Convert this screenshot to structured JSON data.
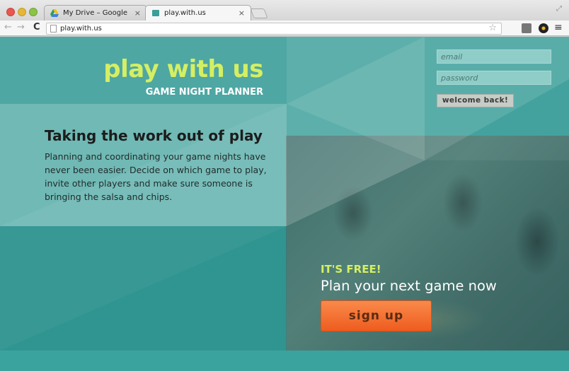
{
  "browser": {
    "tabs": [
      {
        "label": "My Drive – Google Drive",
        "icon": "google-drive-icon",
        "active": false
      },
      {
        "label": "play.with.us",
        "icon": "page-favicon",
        "active": true
      }
    ],
    "tab_close_glyph": "×",
    "url": "play.with.us"
  },
  "brand": {
    "title": "play with us",
    "subtitle": "GAME NIGHT PLANNER",
    "accent_color": "#d5ef63"
  },
  "intro": {
    "headline": "Taking the work out of play",
    "body": "Planning and coordinating your game nights have never been easier. Decide on which game to play, invite other players and make sure someone is bringing the salsa and chips."
  },
  "login": {
    "email_placeholder": "email",
    "password_placeholder": "password",
    "button_label": "welcome back!"
  },
  "cta": {
    "kicker": "IT'S FREE!",
    "title": "Plan your next game now",
    "button_label": "sign up",
    "button_color": "#f26b2b"
  },
  "colors": {
    "background": "#3a9e99"
  }
}
